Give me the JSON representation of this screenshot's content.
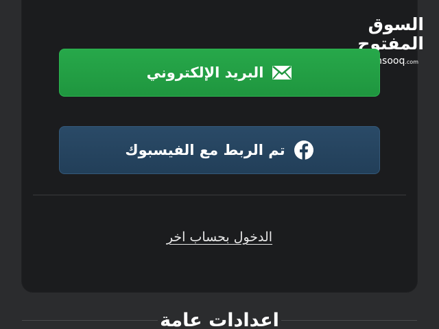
{
  "logo": {
    "arabic": "السوق المفتوح",
    "english": "opensooq",
    "domain_suffix": ".com"
  },
  "buttons": {
    "email": {
      "label": "البريد الإلكتروني",
      "icon": "envelope-icon",
      "color": "#27a84a"
    },
    "facebook": {
      "label": "تم الربط مع الفيسبوك",
      "icon": "facebook-icon",
      "color": "#2a4a67"
    }
  },
  "switch_account_link": "الدخول بحساب اخر",
  "general_settings": {
    "title": "اعدادات عامة"
  }
}
